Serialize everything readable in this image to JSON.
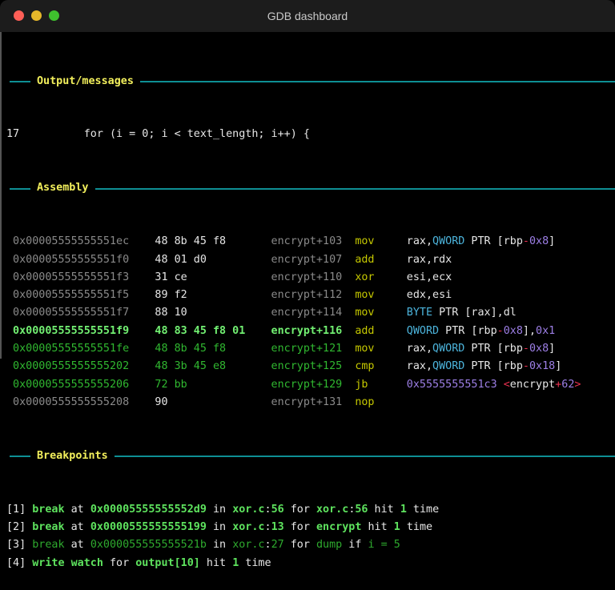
{
  "window": {
    "title": "GDB dashboard"
  },
  "sections": {
    "output": "Output/messages",
    "assembly": "Assembly",
    "breakpoints": "Breakpoints"
  },
  "colors": {
    "header_rule": "#0e8f94",
    "header_text": "#f2ef5c",
    "current": "#72f072",
    "upcoming": "#30b830",
    "past": "#8a8a8a",
    "mnemonic": "#c5c800"
  },
  "output": {
    "line_no": "17",
    "code": "for (i = 0; i < text_length; i++) {"
  },
  "assembly": [
    {
      "state": "past",
      "addr": "0x00005555555551ec",
      "bytes": "48 8b 45 f8",
      "func": "encrypt+103",
      "mnem": "mov",
      "ops": [
        [
          "rax,",
          "white"
        ],
        [
          "QWORD",
          "cyan"
        ],
        [
          " PTR [rbp",
          "white"
        ],
        [
          "-",
          "red"
        ],
        [
          "0x8",
          "purple"
        ],
        [
          "]",
          "white"
        ]
      ]
    },
    {
      "state": "past",
      "addr": "0x00005555555551f0",
      "bytes": "48 01 d0",
      "func": "encrypt+107",
      "mnem": "add",
      "ops": [
        [
          "rax,rdx",
          "white"
        ]
      ]
    },
    {
      "state": "past",
      "addr": "0x00005555555551f3",
      "bytes": "31 ce",
      "func": "encrypt+110",
      "mnem": "xor",
      "ops": [
        [
          "esi,ecx",
          "white"
        ]
      ]
    },
    {
      "state": "past",
      "addr": "0x00005555555551f5",
      "bytes": "89 f2",
      "func": "encrypt+112",
      "mnem": "mov",
      "ops": [
        [
          "edx,esi",
          "white"
        ]
      ]
    },
    {
      "state": "past",
      "addr": "0x00005555555551f7",
      "bytes": "88 10",
      "func": "encrypt+114",
      "mnem": "mov",
      "ops": [
        [
          "BYTE",
          "cyan"
        ],
        [
          " PTR [rax],dl",
          "white"
        ]
      ]
    },
    {
      "state": "current",
      "addr": "0x00005555555551f9",
      "bytes": "48 83 45 f8 01",
      "func": "encrypt+116",
      "mnem": "add",
      "ops": [
        [
          "QWORD",
          "cyan"
        ],
        [
          " PTR [rbp",
          "white"
        ],
        [
          "-",
          "red"
        ],
        [
          "0x8",
          "purple"
        ],
        [
          "],",
          "white"
        ],
        [
          "0x1",
          "purple"
        ]
      ]
    },
    {
      "state": "upcoming",
      "addr": "0x00005555555551fe",
      "bytes": "48 8b 45 f8",
      "func": "encrypt+121",
      "mnem": "mov",
      "ops": [
        [
          "rax,",
          "white"
        ],
        [
          "QWORD",
          "cyan"
        ],
        [
          " PTR [rbp",
          "white"
        ],
        [
          "-",
          "red"
        ],
        [
          "0x8",
          "purple"
        ],
        [
          "]",
          "white"
        ]
      ]
    },
    {
      "state": "upcoming",
      "addr": "0x0000555555555202",
      "bytes": "48 3b 45 e8",
      "func": "encrypt+125",
      "mnem": "cmp",
      "ops": [
        [
          "rax,",
          "white"
        ],
        [
          "QWORD",
          "cyan"
        ],
        [
          " PTR [rbp",
          "white"
        ],
        [
          "-",
          "red"
        ],
        [
          "0x18",
          "purple"
        ],
        [
          "]",
          "white"
        ]
      ]
    },
    {
      "state": "upcoming",
      "addr": "0x0000555555555206",
      "bytes": "72 bb",
      "func": "encrypt+129",
      "mnem": "jb",
      "ops": [
        [
          "0x5555555551c3",
          "purple"
        ],
        [
          " ",
          "white"
        ],
        [
          "<",
          "red"
        ],
        [
          "encrypt",
          "white"
        ],
        [
          "+",
          "red"
        ],
        [
          "62",
          "purple"
        ],
        [
          ">",
          "red"
        ]
      ]
    },
    {
      "state": "past",
      "addr": "0x0000555555555208",
      "bytes": "90",
      "func": "encrypt+131",
      "mnem": "nop",
      "ops": []
    }
  ],
  "breakpoints": [
    [
      [
        "[1] ",
        "white"
      ],
      [
        "break",
        "bpg"
      ],
      [
        " at ",
        "white"
      ],
      [
        "0x00005555555552d9",
        "bpg"
      ],
      [
        " in ",
        "white"
      ],
      [
        "xor.c",
        "bpg"
      ],
      [
        ":",
        "white"
      ],
      [
        "56",
        "bpg"
      ],
      [
        " for ",
        "white"
      ],
      [
        "xor.c",
        "bpg"
      ],
      [
        ":",
        "white"
      ],
      [
        "56",
        "bpg"
      ],
      [
        " hit ",
        "white"
      ],
      [
        "1",
        "bpg"
      ],
      [
        " time",
        "white"
      ]
    ],
    [
      [
        "[2] ",
        "white"
      ],
      [
        "break",
        "bpg"
      ],
      [
        " at ",
        "white"
      ],
      [
        "0x0000555555555199",
        "bpg"
      ],
      [
        " in ",
        "white"
      ],
      [
        "xor.c",
        "bpg"
      ],
      [
        ":",
        "white"
      ],
      [
        "13",
        "bpg"
      ],
      [
        " for ",
        "white"
      ],
      [
        "encrypt",
        "bpg"
      ],
      [
        " hit ",
        "white"
      ],
      [
        "1",
        "bpg"
      ],
      [
        " time",
        "white"
      ]
    ],
    [
      [
        "[3] ",
        "white"
      ],
      [
        "break",
        "dg"
      ],
      [
        " at ",
        "white"
      ],
      [
        "0x000055555555521b",
        "dg"
      ],
      [
        " in ",
        "white"
      ],
      [
        "xor.c",
        "dg"
      ],
      [
        ":",
        "white"
      ],
      [
        "27",
        "dg"
      ],
      [
        " for ",
        "white"
      ],
      [
        "dump",
        "dg"
      ],
      [
        " if ",
        "white"
      ],
      [
        "i = 5",
        "dg"
      ]
    ],
    [
      [
        "[4] ",
        "white"
      ],
      [
        "write watch",
        "bpg"
      ],
      [
        " for ",
        "white"
      ],
      [
        "output[10]",
        "bpg"
      ],
      [
        " hit ",
        "white"
      ],
      [
        "1",
        "bpg"
      ],
      [
        " time",
        "white"
      ]
    ]
  ]
}
